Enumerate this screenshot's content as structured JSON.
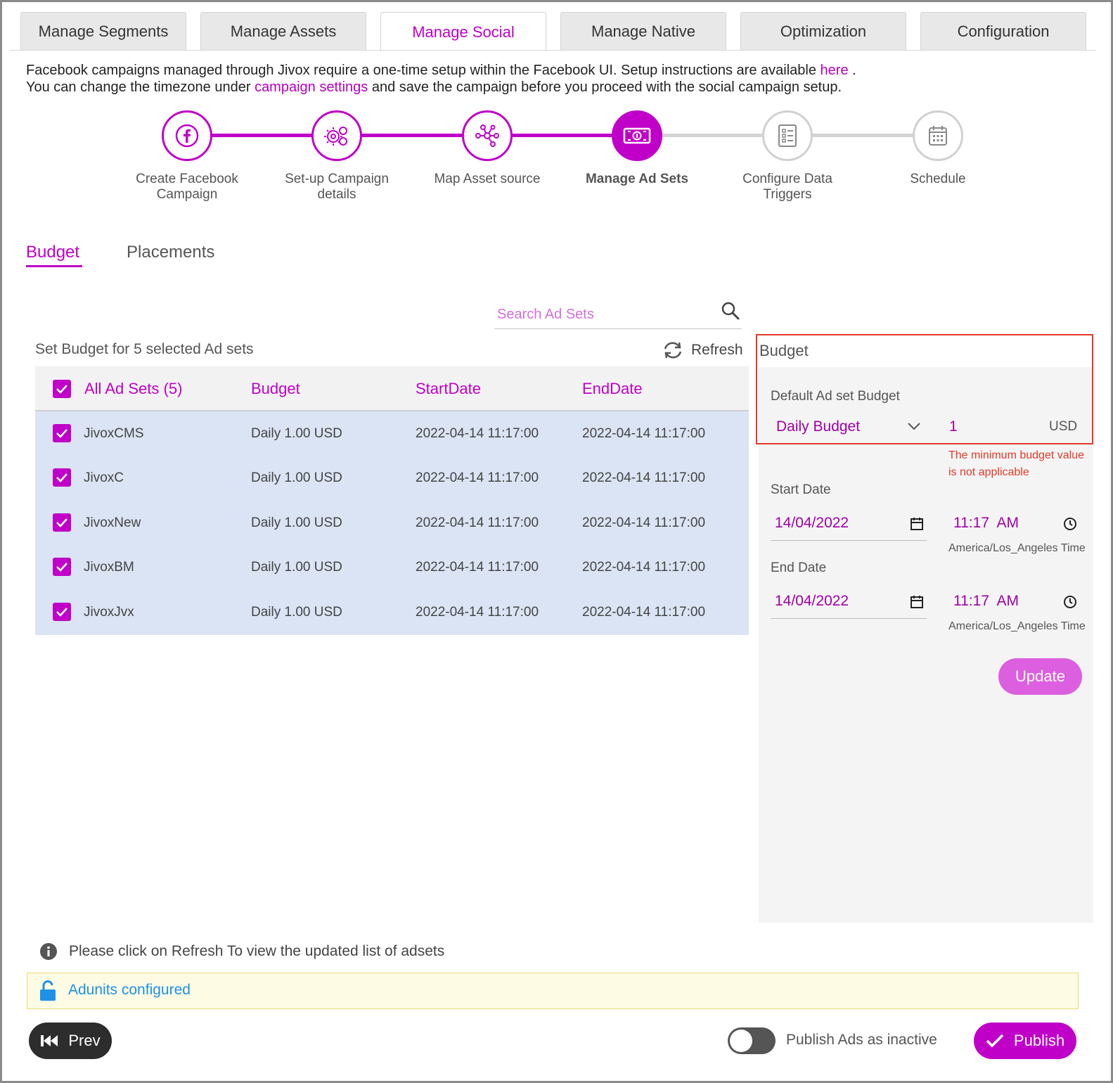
{
  "tabs": [
    {
      "label": "Manage Segments",
      "active": false
    },
    {
      "label": "Manage Assets",
      "active": false
    },
    {
      "label": "Manage Social",
      "active": true
    },
    {
      "label": "Manage Native",
      "active": false
    },
    {
      "label": "Optimization",
      "active": false
    },
    {
      "label": "Configuration",
      "active": false
    }
  ],
  "intro": {
    "line1_text": "Facebook campaigns managed through Jivox require a one-time setup within the Facebook UI. Setup instructions are available ",
    "line1_link": "here",
    "line1_end": " .",
    "line2_start": "You can change the timezone under ",
    "line2_link": "campaign settings",
    "line2_end": " and save the campaign before you proceed with the social campaign setup."
  },
  "steps": [
    {
      "label1": "Create Facebook",
      "label2": "Campaign",
      "icon": "facebook-icon",
      "state": "done"
    },
    {
      "label1": "Set-up Campaign",
      "label2": "details",
      "icon": "gears-icon",
      "state": "done"
    },
    {
      "label1": "Map Asset source",
      "label2": "",
      "icon": "network-icon",
      "state": "done"
    },
    {
      "label1": "Manage Ad Sets",
      "label2": "",
      "icon": "money-icon",
      "state": "current"
    },
    {
      "label1": "Configure Data",
      "label2": "Triggers",
      "icon": "checklist-icon",
      "state": "todo"
    },
    {
      "label1": "Schedule",
      "label2": "",
      "icon": "calendar-icon",
      "state": "todo"
    }
  ],
  "subtabs": {
    "budget": "Budget",
    "placements": "Placements"
  },
  "search": {
    "placeholder": "Search Ad Sets"
  },
  "table_caption": "Set Budget for 5 selected Ad sets",
  "refresh_label": "Refresh",
  "table": {
    "headers": {
      "all": "All Ad Sets (5)",
      "budget": "Budget",
      "start": "StartDate",
      "end": "EndDate"
    },
    "rows": [
      {
        "name": "JivoxCMS",
        "budget": "Daily 1.00 USD",
        "start": "2022-04-14 11:17:00",
        "end": "2022-04-14 11:17:00"
      },
      {
        "name": "JivoxC",
        "budget": "Daily 1.00 USD",
        "start": "2022-04-14 11:17:00",
        "end": "2022-04-14 11:17:00"
      },
      {
        "name": "JivoxNew",
        "budget": "Daily 1.00 USD",
        "start": "2022-04-14 11:17:00",
        "end": "2022-04-14 11:17:00"
      },
      {
        "name": "JivoxBM",
        "budget": "Daily 1.00 USD",
        "start": "2022-04-14 11:17:00",
        "end": "2022-04-14 11:17:00"
      },
      {
        "name": "JivoxJvx",
        "budget": "Daily 1.00 USD",
        "start": "2022-04-14 11:17:00",
        "end": "2022-04-14 11:17:00"
      }
    ]
  },
  "panel": {
    "title": "Budget",
    "default_label": "Default Ad set Budget",
    "budget_type": "Daily Budget",
    "amount": "1",
    "currency": "USD",
    "error1": "The minimum budget value",
    "error2": "is not applicable",
    "start_label": "Start Date",
    "start_date": "14/04/2022",
    "start_time": "11:17  AM",
    "start_tz": "America/Los_Angeles Time",
    "end_label": "End Date",
    "end_date": "14/04/2022",
    "end_time": "11:17  AM",
    "end_tz": "America/Los_Angeles Time",
    "update_label": "Update"
  },
  "info_text": "Please click on Refresh To view the updated list of adsets",
  "notice_text": "Adunits configured",
  "footer": {
    "prev": "Prev",
    "publish_inactive": "Publish Ads as inactive",
    "publish": "Publish"
  },
  "colors": {
    "accent": "#c000c8",
    "error": "#e23a2a",
    "link_blue": "#1e90e6"
  }
}
